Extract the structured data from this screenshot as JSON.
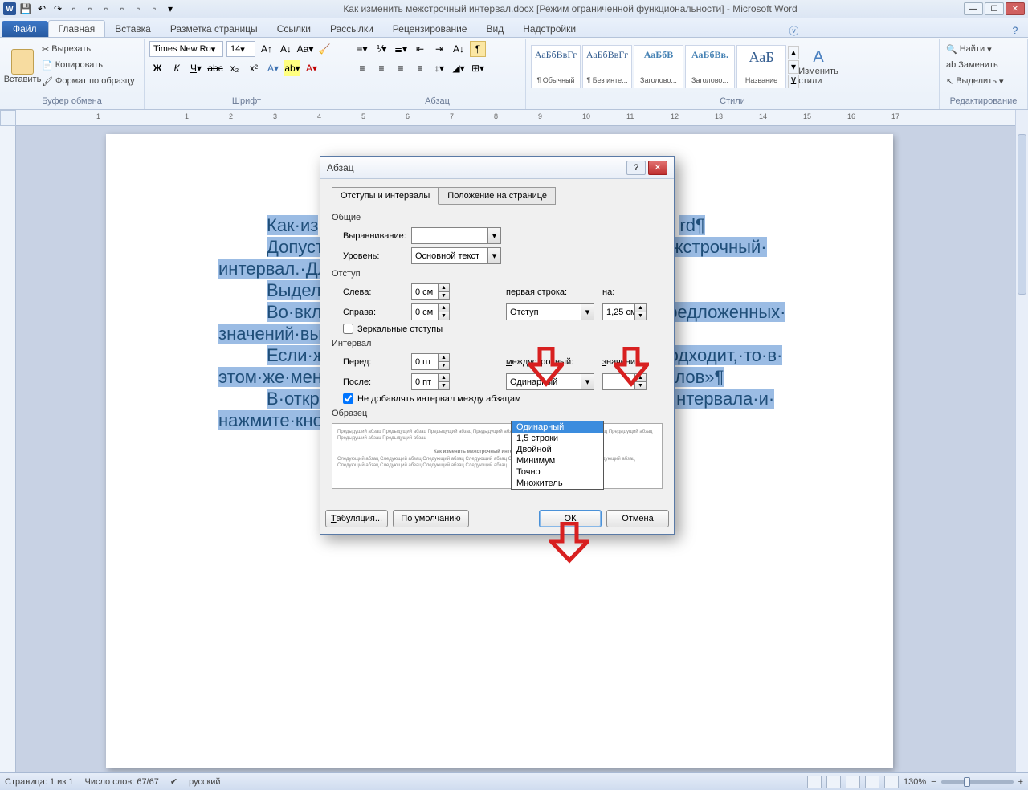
{
  "title": "Как изменить межстрочный интервал.docx [Режим ограниченной функциональности] - Microsoft Word",
  "tabs": {
    "file": "Файл",
    "home": "Главная",
    "insert": "Вставка",
    "layout": "Разметка страницы",
    "references": "Ссылки",
    "mailings": "Рассылки",
    "review": "Рецензирование",
    "view": "Вид",
    "addins": "Надстройки"
  },
  "ribbon": {
    "paste": "Вставить",
    "cut": "Вырезать",
    "copy": "Копировать",
    "format_painter": "Формат по образцу",
    "clipboard": "Буфер обмена",
    "font_name": "Times New Ro",
    "font_size": "14",
    "font_group": "Шрифт",
    "paragraph_group": "Абзац",
    "styles_group": "Стили",
    "editing_group": "Редактирование",
    "change_styles": "Изменить стили",
    "find": "Найти",
    "replace": "Заменить",
    "select": "Выделить",
    "style_sample": "АаБбВвГг",
    "style_sample2": "АаБбВ",
    "style_sample3": "АаБбВв.",
    "style_sample4": "АаБ",
    "style1": "¶ Обычный",
    "style2": "¶ Без инте...",
    "style3": "Заголово...",
    "style4": "Заголово...",
    "style5": "Название"
  },
  "doc": {
    "l1a": "Как·из",
    "l1b": "rd¶",
    "l2a": "Допуст",
    "l2b": "енить·межстрочный·",
    "l3": "интервал.·Дл",
    "l4": "Выдели",
    "l5a": "Во·вкл",
    "l5b": "·и·из·предложенных·",
    "l6": "значений·выб",
    "l7a": "Если·ж",
    "l7b": "м·не·подходит,·то·в·",
    "l8a": "этом·же·меню",
    "l8b": "х·интервалов»¶",
    "l9a": "В·откр",
    "l9b": "метры·интервала·и·",
    "l10": "нажмите·кно"
  },
  "dialog": {
    "title": "Абзац",
    "tab1": "Отступы и интервалы",
    "tab2": "Положение на странице",
    "general": "Общие",
    "alignment": "Выравнивание:",
    "level": "Уровень:",
    "level_value": "Основной текст",
    "indent": "Отступ",
    "left": "Слева:",
    "right": "Справа:",
    "zero_cm": "0 см",
    "first_line": "первая строка:",
    "firstline_value": "Отступ",
    "by": "на:",
    "by_value": "1,25 см",
    "mirror": "Зеркальные отступы",
    "spacing": "Интервал",
    "before": "Перед:",
    "after": "После:",
    "zero_pt": "0 пт",
    "line_spacing": "междустрочный:",
    "line_spacing_value": "Одинарный",
    "value": "значение:",
    "no_space": "Не добавлять интервал между абзацам",
    "preview": "Образец",
    "preview_title": "Как изменить межстрочный интервал Microsoft Word",
    "tabs_btn": "Табуляция...",
    "default_btn": "По умолчанию",
    "ok": "ОК",
    "cancel": "Отмена",
    "options": [
      "Одинарный",
      "1,5 строки",
      "Двойной",
      "Минимум",
      "Точно",
      "Множитель"
    ]
  },
  "status": {
    "page": "Страница: 1 из 1",
    "words": "Число слов: 67/67",
    "lang": "русский",
    "zoom": "130%"
  },
  "ruler_marks": [
    "1",
    "",
    "1",
    "2",
    "3",
    "4",
    "5",
    "6",
    "7",
    "8",
    "9",
    "10",
    "11",
    "12",
    "13",
    "14",
    "15",
    "16",
    "17"
  ]
}
